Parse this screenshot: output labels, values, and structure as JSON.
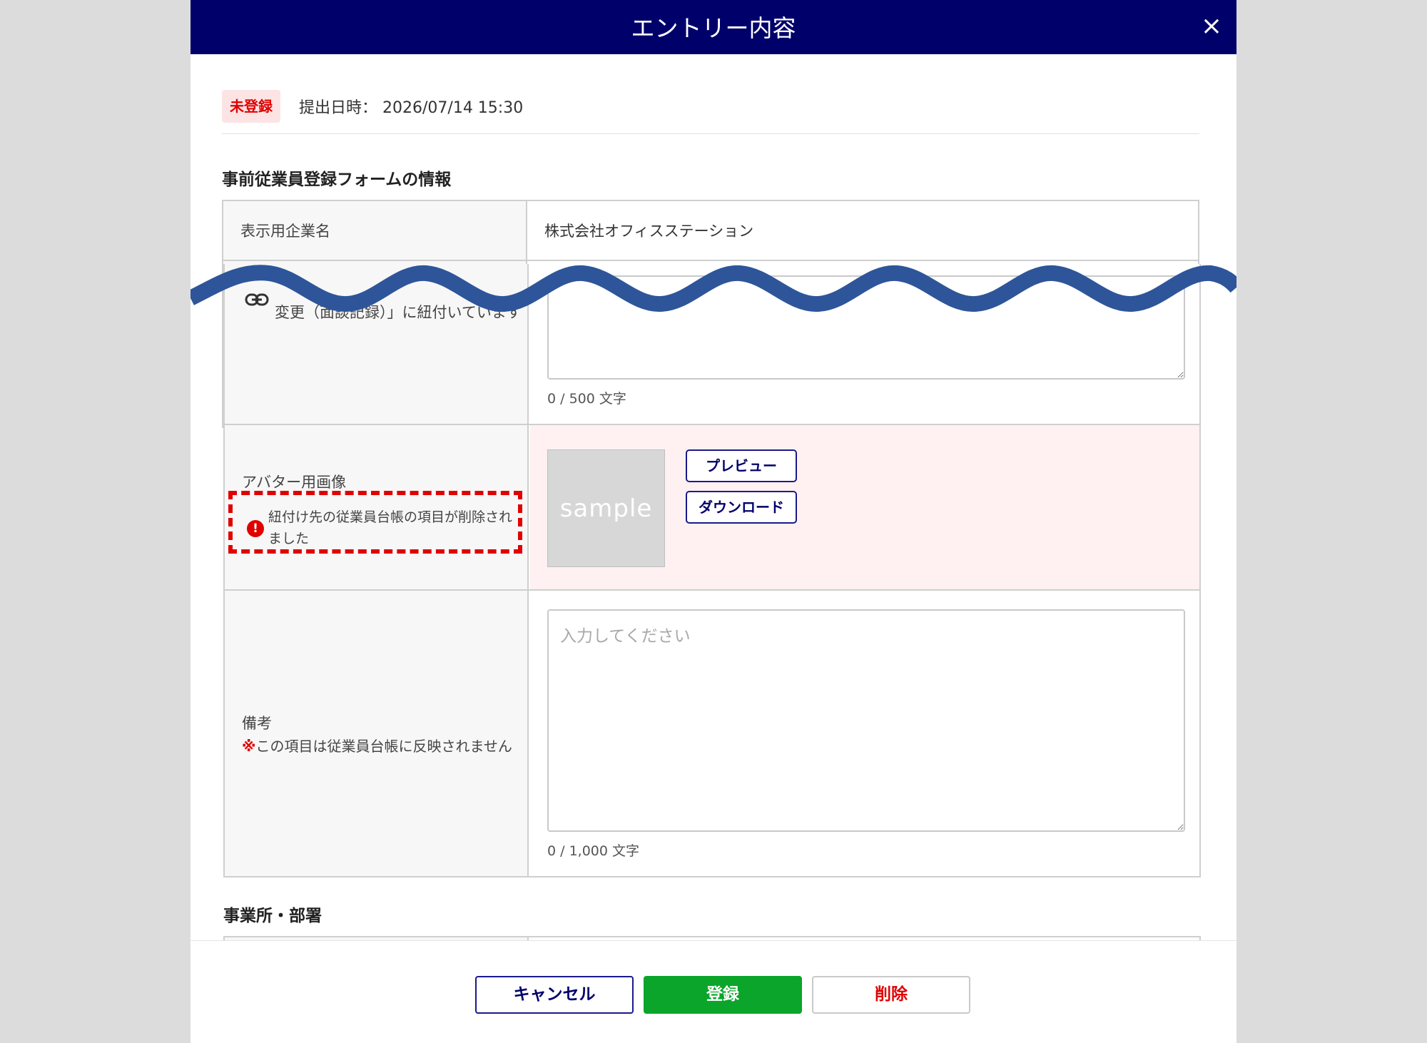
{
  "modal": {
    "title": "エントリー内容",
    "close_label": "×"
  },
  "status": {
    "badge": "未登録",
    "submitted_label": "提出日時：",
    "submitted_value": "2026/07/14 15:30"
  },
  "section1": {
    "title": "事前従業員登録フォームの情報",
    "rows": {
      "company": {
        "label": "表示用企業名",
        "value": "株式会社オフィスステーション"
      },
      "linked": {
        "label_line2": "変更（面談記録）」に紐付いています",
        "counter": "0 / 500 文字"
      },
      "avatar": {
        "label": "アバター用画像",
        "image_text": "sample",
        "preview_label": "プレビュー",
        "download_label": "ダウンロード",
        "warning": "紐付け先の従業員台帳の項目が削除されました"
      },
      "notes": {
        "label": "備考",
        "note_mark": "※",
        "note": "この項目は従業員台帳に反映されません",
        "placeholder": "入力してください",
        "counter": "0 / 1,000 文字"
      }
    }
  },
  "section2": {
    "title": "事業所・部署"
  },
  "footer": {
    "cancel_label": "キャンセル",
    "register_label": "登録",
    "delete_label": "削除"
  },
  "colors": {
    "header": "#00006b",
    "register": "#0aa52a",
    "danger": "#e00000",
    "wave": "#2e5599",
    "error_bg": "#fff1f1"
  },
  "icons": [
    "close-icon",
    "link-icon",
    "error-icon"
  ]
}
